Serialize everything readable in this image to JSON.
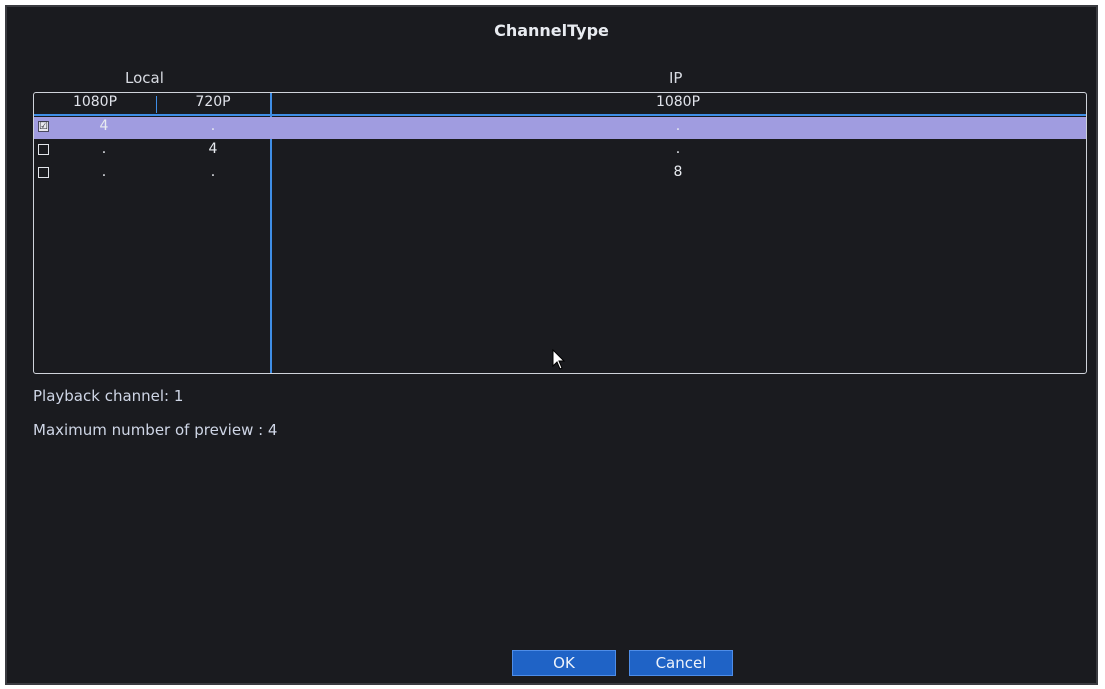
{
  "dialog": {
    "title": "ChannelType"
  },
  "groups": {
    "local": "Local",
    "ip": "IP"
  },
  "columns": [
    "1080P",
    "720P",
    "1080P"
  ],
  "rows": [
    {
      "checked": true,
      "local_1080": "4",
      "local_720": ".",
      "ip_1080": "."
    },
    {
      "checked": false,
      "local_1080": ".",
      "local_720": "4",
      "ip_1080": "."
    },
    {
      "checked": false,
      "local_1080": ".",
      "local_720": ".",
      "ip_1080": "8"
    }
  ],
  "info": {
    "playback": "Playback channel: 1",
    "preview": "Maximum number of preview   : 4"
  },
  "buttons": {
    "ok": "OK",
    "cancel": "Cancel"
  },
  "icons": {
    "checkbox_checked": "☑",
    "cursor": "mouse-pointer-icon"
  },
  "colors": {
    "background": "#1a1b1f",
    "accent": "#3f8ee6",
    "selection": "#a09ce0",
    "button": "#1f63c6"
  }
}
